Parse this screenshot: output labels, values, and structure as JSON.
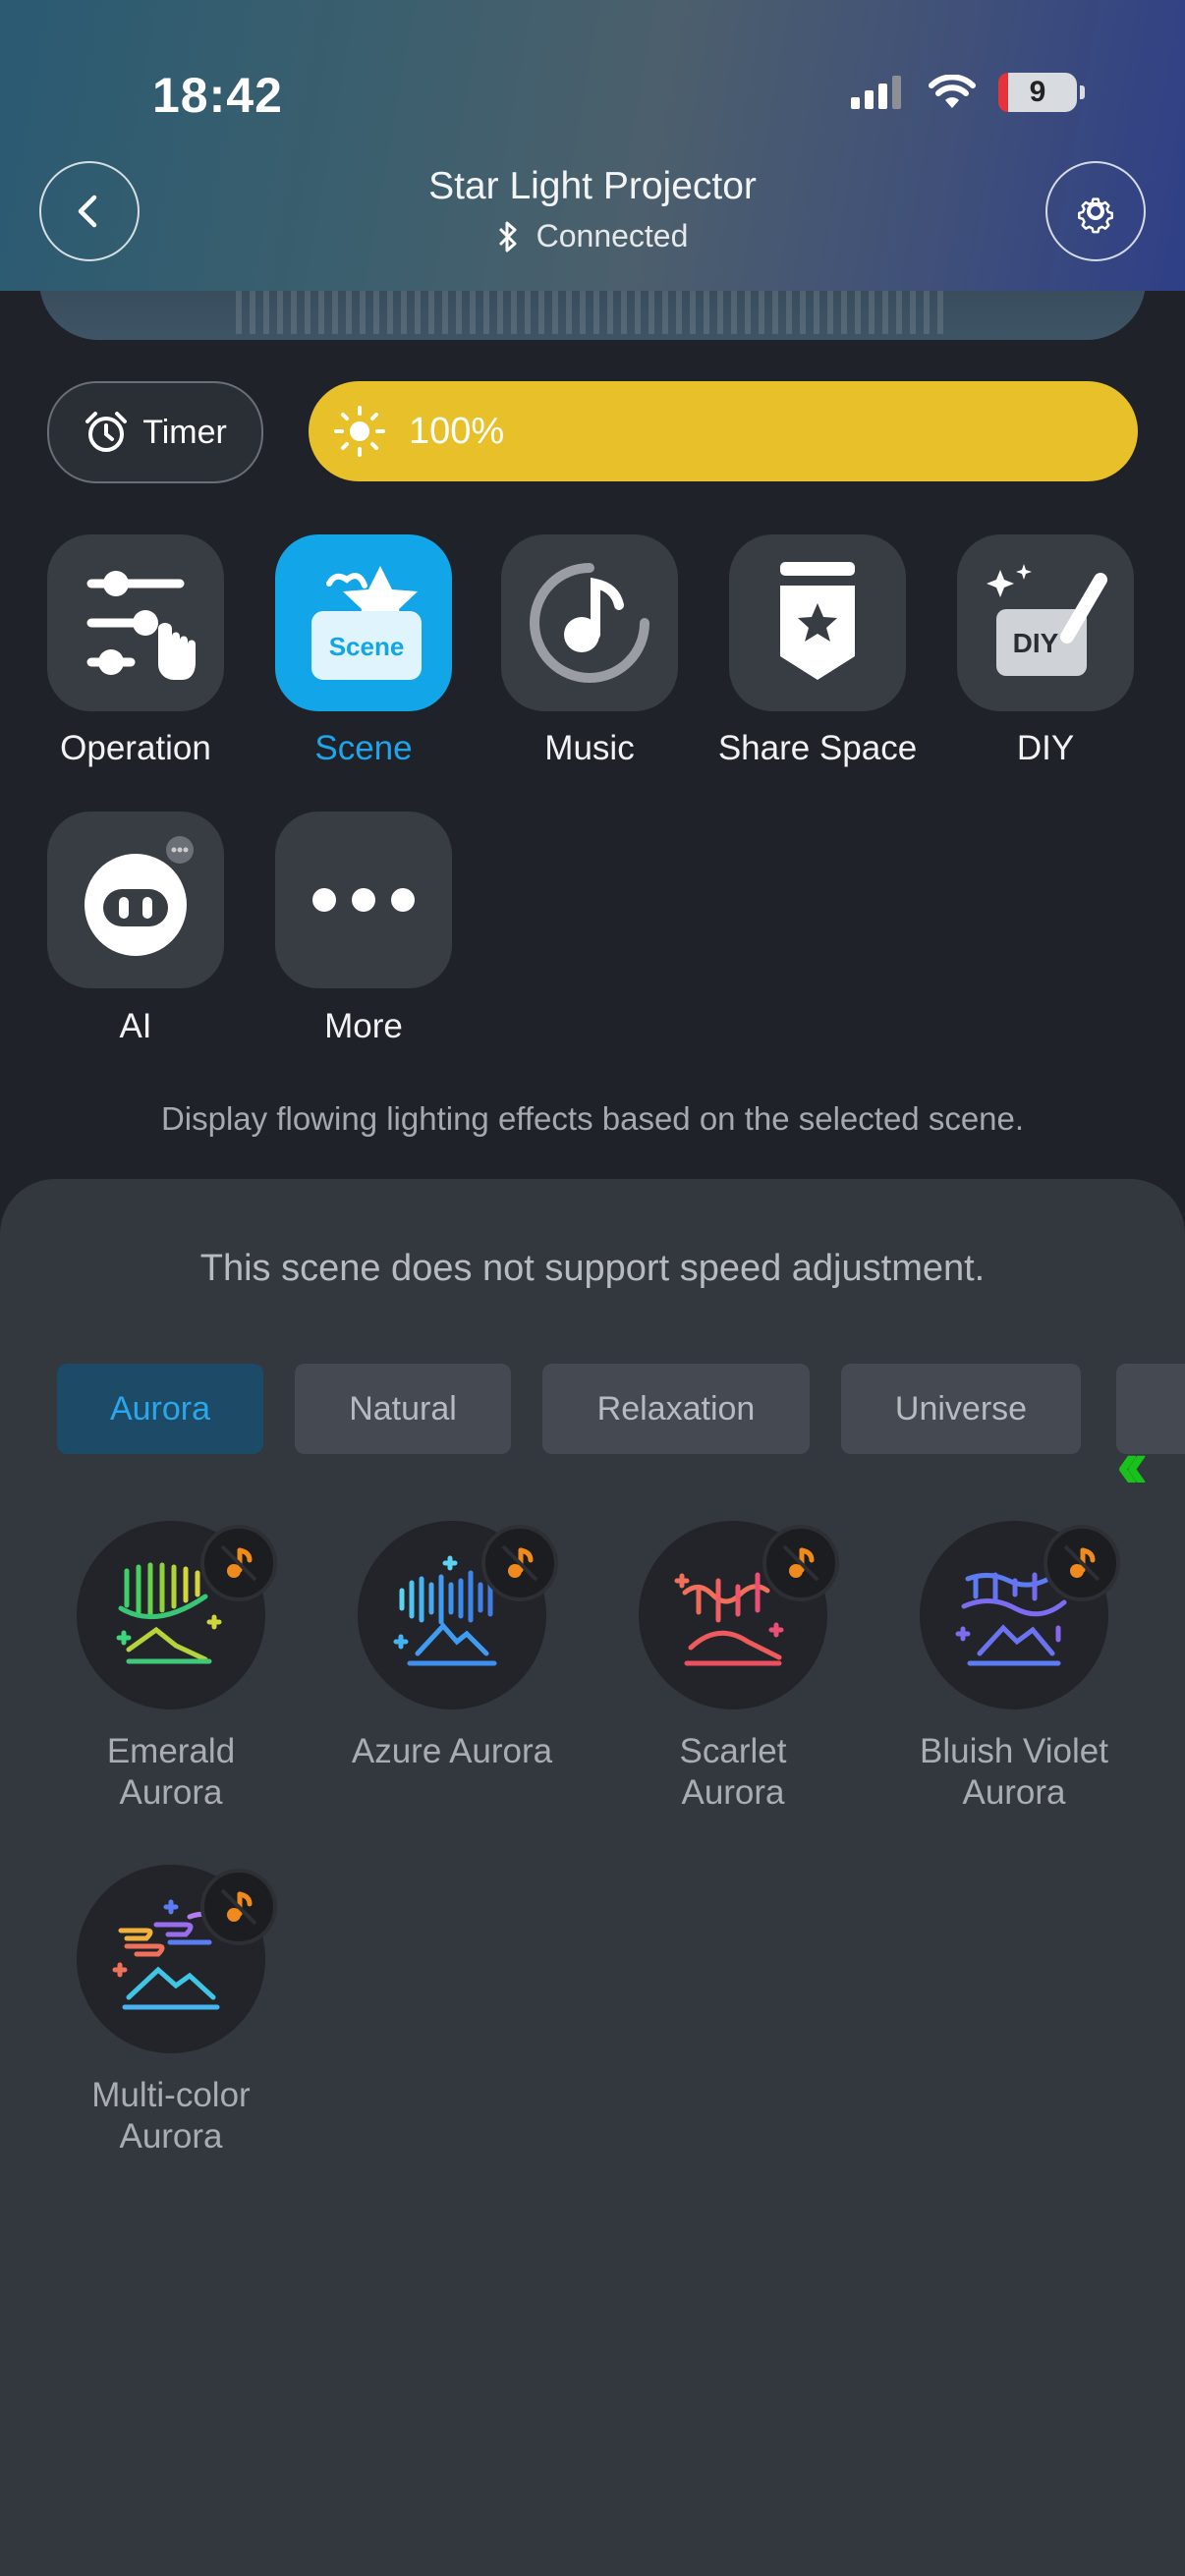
{
  "status_bar": {
    "time": "18:42",
    "battery": "9"
  },
  "header": {
    "title": "Star Light Projector",
    "connection": "Connected"
  },
  "timer": {
    "label": "Timer"
  },
  "brightness": {
    "value": "100%"
  },
  "features": [
    {
      "label": "Operation"
    },
    {
      "label": "Scene",
      "badge": "Scene"
    },
    {
      "label": "Music"
    },
    {
      "label": "Share Space"
    },
    {
      "label": "DIY",
      "badge": "DIY"
    },
    {
      "label": "AI"
    },
    {
      "label": "More"
    }
  ],
  "description": "Display flowing lighting effects based on the selected scene.",
  "sheet": {
    "speed_note": "This scene does not support speed adjustment.",
    "tabs": [
      "Aurora",
      "Natural",
      "Relaxation",
      "Universe"
    ],
    "active_tab": "Aurora",
    "scenes": [
      {
        "label1": "Emerald",
        "label2": "Aurora"
      },
      {
        "label1": "Azure Aurora",
        "label2": ""
      },
      {
        "label1": "Scarlet",
        "label2": "Aurora"
      },
      {
        "label1": "Bluish Violet",
        "label2": "Aurora"
      },
      {
        "label1": "Multi-color",
        "label2": "Aurora"
      }
    ]
  },
  "colors": {
    "accent_blue": "#12a6e8",
    "brightness_yellow": "#e7c02a",
    "no_music_orange": "#f08a1c",
    "scroll_hint_green": "#18c21a"
  }
}
